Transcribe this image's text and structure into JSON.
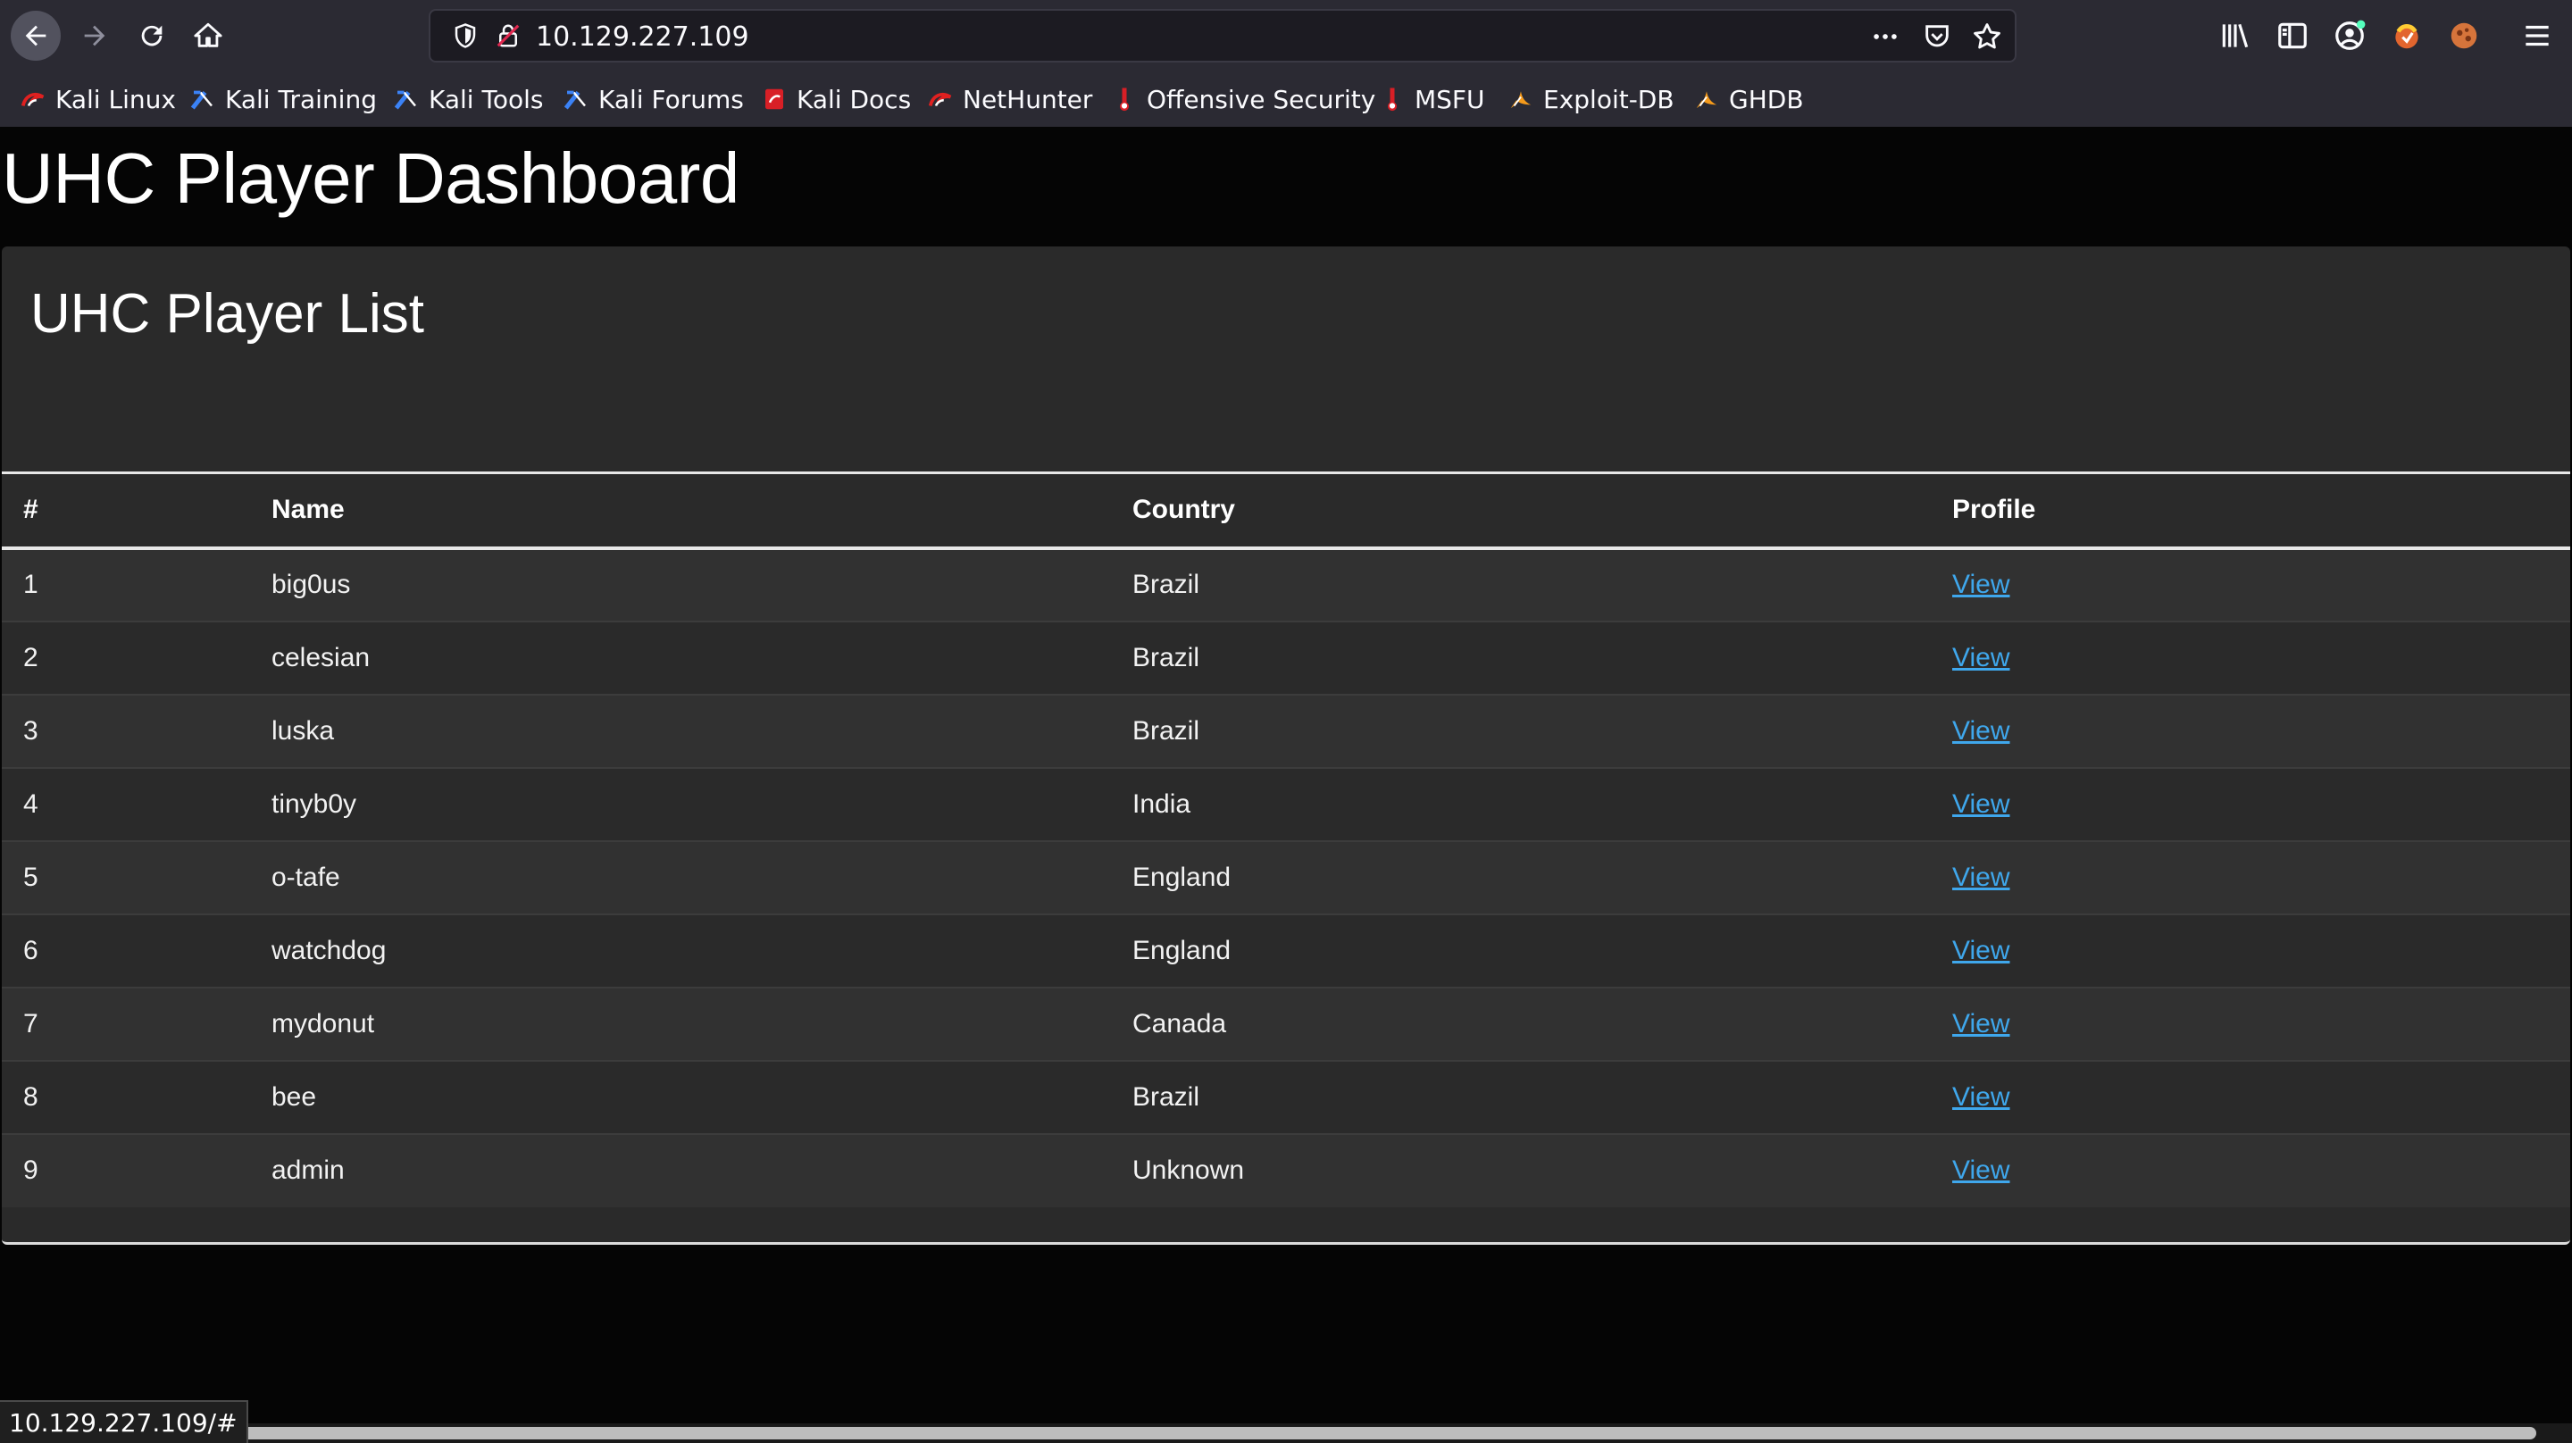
{
  "browser": {
    "url": "10.129.227.109",
    "status_url": "10.129.227.109/#",
    "icons": [
      "back-icon",
      "forward-icon",
      "reload-icon",
      "home-icon",
      "shield-icon",
      "insecure-lock-icon",
      "page-actions-icon",
      "pocket-icon",
      "bookmark-star-icon",
      "library-icon",
      "sidebar-icon",
      "account-icon",
      "extension-icon",
      "extension-icon",
      "menu-icon"
    ],
    "bookmarks": [
      {
        "label": "Kali Linux",
        "icon": "kali-dragon-icon"
      },
      {
        "label": "Kali Training",
        "icon": "kali-training-icon"
      },
      {
        "label": "Kali Tools",
        "icon": "kali-tools-icon"
      },
      {
        "label": "Kali Forums",
        "icon": "kali-forums-icon"
      },
      {
        "label": "Kali Docs",
        "icon": "kali-docs-icon"
      },
      {
        "label": "NetHunter",
        "icon": "nethunter-icon"
      },
      {
        "label": "Offensive Security",
        "icon": "offsec-icon"
      },
      {
        "label": "MSFU",
        "icon": "msfu-icon"
      },
      {
        "label": "Exploit-DB",
        "icon": "exploitdb-icon"
      },
      {
        "label": "GHDB",
        "icon": "ghdb-icon"
      }
    ]
  },
  "page": {
    "title": "UHC Player Dashboard",
    "card_title": "UHC Player List",
    "table": {
      "headers": [
        "#",
        "Name",
        "Country",
        "Profile"
      ],
      "rows": [
        {
          "num": "1",
          "name": "big0us",
          "country": "Brazil",
          "profile": "View"
        },
        {
          "num": "2",
          "name": "celesian",
          "country": "Brazil",
          "profile": "View"
        },
        {
          "num": "3",
          "name": "luska",
          "country": "Brazil",
          "profile": "View"
        },
        {
          "num": "4",
          "name": "tinyb0y",
          "country": "India",
          "profile": "View"
        },
        {
          "num": "5",
          "name": "o-tafe",
          "country": "England",
          "profile": "View"
        },
        {
          "num": "6",
          "name": "watchdog",
          "country": "England",
          "profile": "View"
        },
        {
          "num": "7",
          "name": "mydonut",
          "country": "Canada",
          "profile": "View"
        },
        {
          "num": "8",
          "name": "bee",
          "country": "Brazil",
          "profile": "View"
        },
        {
          "num": "9",
          "name": "admin",
          "country": "Unknown",
          "profile": "View"
        }
      ]
    }
  },
  "colors": {
    "chrome": "#2b2a33",
    "page_bg": "#050505",
    "card_bg": "#2a2a2a",
    "link": "#3fa7ec"
  }
}
